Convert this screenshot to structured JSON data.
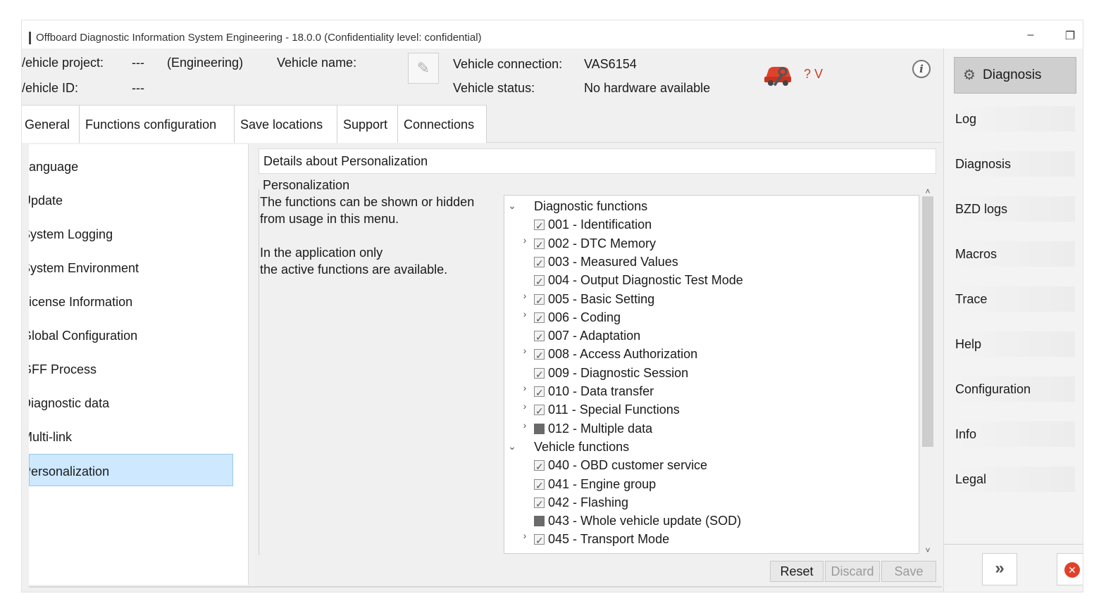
{
  "window": {
    "title": "Offboard Diagnostic Information System Engineering - 18.0.0 (Confidentiality level: confidential)",
    "minimize_glyph": "–",
    "maximize_glyph": "❐"
  },
  "header": {
    "vehicle_project_label": "/ehicle project:",
    "vehicle_project_value": "---",
    "vehicle_project_mode": "(Engineering)",
    "vehicle_name_label": "Vehicle name:",
    "vehicle_id_label": "/ehicle ID:",
    "vehicle_id_value": "---",
    "vehicle_connection_label": "Vehicle connection:",
    "vehicle_connection_value": "VAS6154",
    "vehicle_status_label": "Vehicle status:",
    "vehicle_status_value": "No hardware available",
    "voltage_text": "? V",
    "icons": [
      "edit-icon",
      "car-wrench-icon",
      "info-icon"
    ],
    "voltage_color": "#d23a2a"
  },
  "tabs": [
    {
      "label": "General"
    },
    {
      "label": "Functions configuration"
    },
    {
      "label": "Save locations"
    },
    {
      "label": "Support"
    },
    {
      "label": "Connections"
    }
  ],
  "left_menu": [
    {
      "label": "Language"
    },
    {
      "label": "Update"
    },
    {
      "label": "System Logging"
    },
    {
      "label": "System Environment"
    },
    {
      "label": "License Information"
    },
    {
      "label": "Global Configuration"
    },
    {
      "label": "GFF Process"
    },
    {
      "label": "Diagnostic data"
    },
    {
      "label": "Multi-link"
    },
    {
      "label": "Personalization",
      "selected": true
    }
  ],
  "content": {
    "details_title": "Details about Personalization",
    "section_title": "Personalization",
    "desc_line1": "The functions can be shown or hidden",
    "desc_line2": "from usage in this menu.",
    "desc_line3": "In the application only",
    "desc_line4": "the active functions are available."
  },
  "tree": {
    "groups": [
      {
        "label": "Diagnostic functions",
        "expanded": true,
        "items": [
          {
            "label": "001 - Identification",
            "state": "checked",
            "expandable": false
          },
          {
            "label": "002 - DTC Memory",
            "state": "checked",
            "expandable": true
          },
          {
            "label": "003 - Measured Values",
            "state": "checked",
            "expandable": false
          },
          {
            "label": "004 - Output Diagnostic Test Mode",
            "state": "checked",
            "expandable": false
          },
          {
            "label": "005 - Basic Setting",
            "state": "checked",
            "expandable": true
          },
          {
            "label": "006 - Coding",
            "state": "checked",
            "expandable": true
          },
          {
            "label": "007 - Adaptation",
            "state": "checked",
            "expandable": false
          },
          {
            "label": "008 - Access Authorization",
            "state": "checked",
            "expandable": true
          },
          {
            "label": "009 - Diagnostic Session",
            "state": "checked",
            "expandable": false
          },
          {
            "label": "010 - Data transfer",
            "state": "checked",
            "expandable": true
          },
          {
            "label": "011 - Special Functions",
            "state": "checked",
            "expandable": true
          },
          {
            "label": "012 - Multiple data",
            "state": "partial",
            "expandable": true
          }
        ]
      },
      {
        "label": "Vehicle functions",
        "expanded": true,
        "items": [
          {
            "label": "040 - OBD customer service",
            "state": "checked",
            "expandable": false
          },
          {
            "label": "041 - Engine group",
            "state": "checked",
            "expandable": false
          },
          {
            "label": "042 - Flashing",
            "state": "checked",
            "expandable": false
          },
          {
            "label": "043 - Whole vehicle update (SOD)",
            "state": "partial",
            "expandable": false
          },
          {
            "label": "045 - Transport Mode",
            "state": "checked",
            "expandable": true
          }
        ]
      }
    ]
  },
  "buttons": {
    "reset": "Reset",
    "discard": "Discard",
    "save": "Save"
  },
  "right_panel": {
    "diagnosis_button": "Diagnosis",
    "items": [
      {
        "label": "Log"
      },
      {
        "label": "Diagnosis"
      },
      {
        "label": "BZD logs"
      },
      {
        "label": "Macros"
      },
      {
        "label": "Trace"
      },
      {
        "label": "Help"
      },
      {
        "label": "Configuration"
      },
      {
        "label": "Info"
      },
      {
        "label": "Legal"
      }
    ]
  },
  "colors": {
    "selection_bg": "#cde8ff",
    "selection_border": "#99c9ef",
    "accent_red": "#e0412b"
  }
}
